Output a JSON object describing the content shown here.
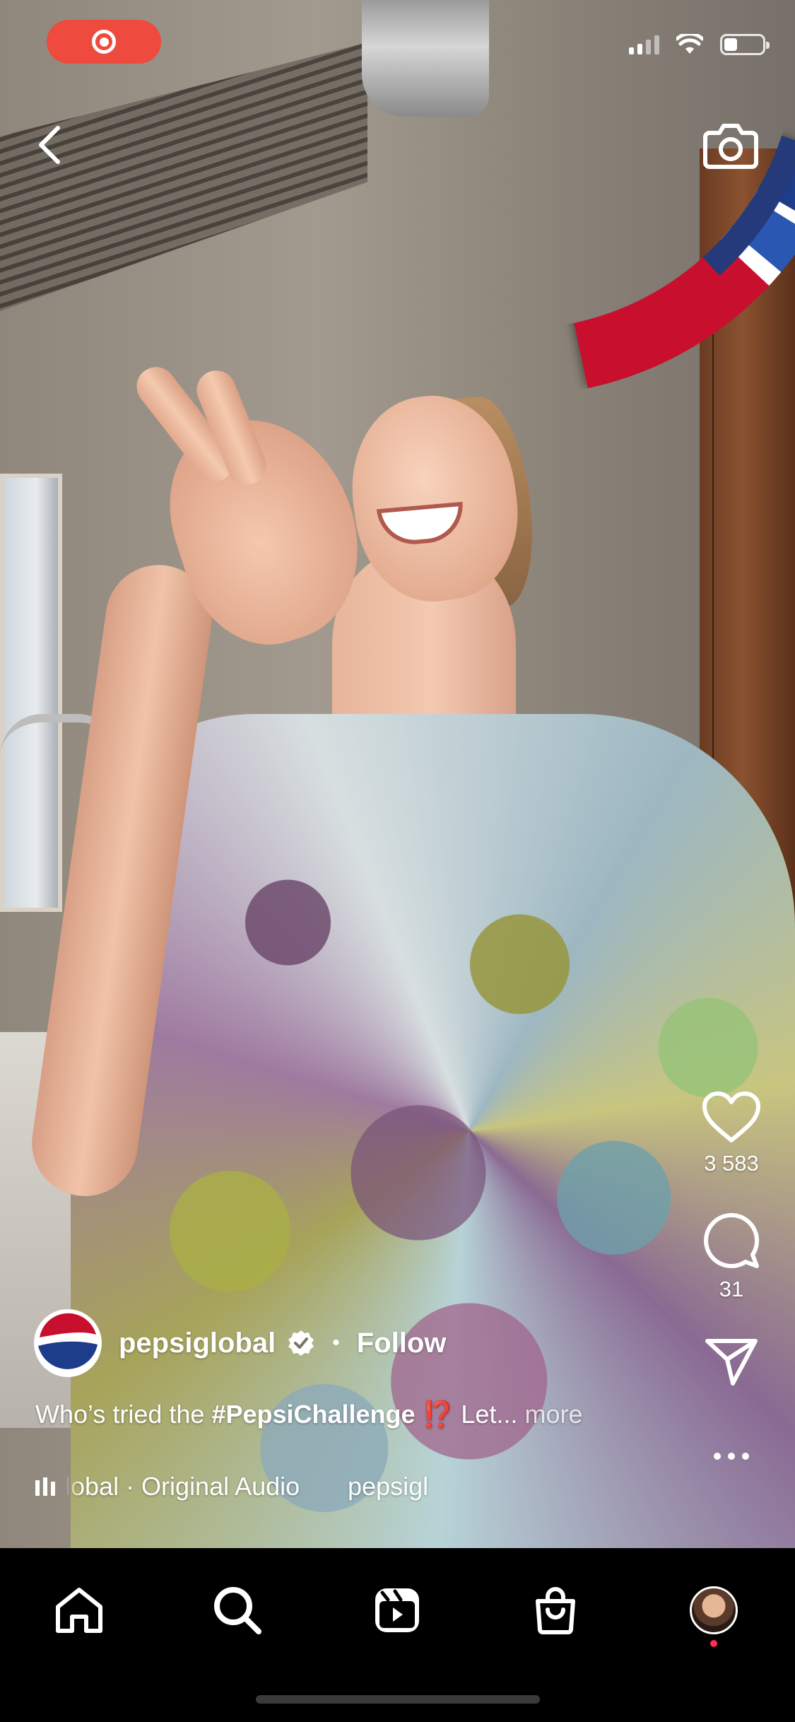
{
  "status_bar": {
    "recording_indicator": "screen-record-icon",
    "icons": [
      "cellular-signal-icon",
      "wifi-icon",
      "battery-icon"
    ],
    "battery_level": 0.35
  },
  "reel": {
    "author": {
      "username": "pepsiglobal",
      "verified": true,
      "separator": "•",
      "follow_label": "Follow"
    },
    "caption": {
      "prefix": "Who’s tried the ",
      "hashtag": "#PepsiChallenge",
      "emoji": "⁉️",
      "suffix": " Let...",
      "more_label": "more"
    },
    "audio": {
      "track": "lobal · Original Audio",
      "next_user": "pepsigl"
    },
    "actions": {
      "likes": "3 583",
      "comments": "31"
    }
  },
  "bottom_nav": {
    "items": [
      "home-icon",
      "search-icon",
      "reels-icon",
      "shop-icon",
      "profile-avatar"
    ],
    "active": "reels"
  },
  "colors": {
    "record_red": "#ee4a3e",
    "pepsi_blue": "#1d3d8a",
    "pepsi_red": "#c8102e",
    "notification_dot": "#ff2d55"
  }
}
